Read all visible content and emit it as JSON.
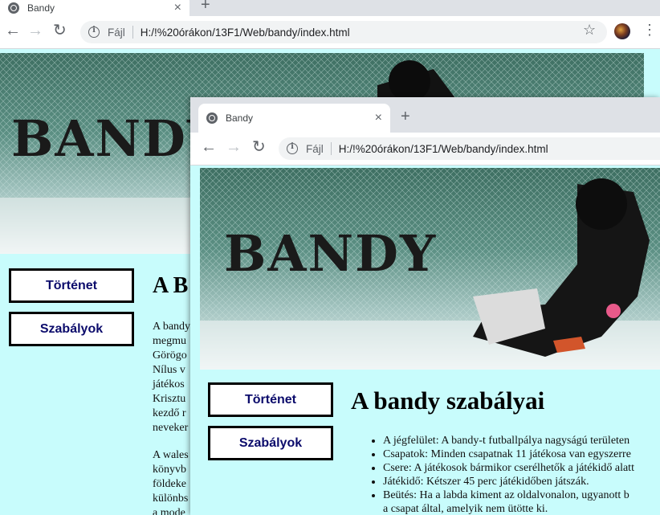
{
  "browser": {
    "tab_title": "Bandy",
    "close_glyph": "×",
    "new_tab_glyph": "+",
    "scheme_label": "Fájl",
    "url": "H:/!%20órákon/13F1/Web/bandy/index.html",
    "menu_glyph": "⋮",
    "star_glyph": "☆"
  },
  "page": {
    "banner_text": "BANDY",
    "nav": [
      "Történet",
      "Szabályok"
    ],
    "back_title_partial": "A B",
    "back_paragraph1": [
      "A bandy",
      "megmu",
      "Görögo",
      "Nílus v",
      "játékos",
      "Krisztu",
      "kezdő r",
      "neveker"
    ],
    "back_paragraph2": [
      "A wales",
      "könyvb",
      "földeke",
      "különbs",
      "a mode"
    ],
    "title": "A bandy szabályai",
    "rules": [
      "A jégfelület: A bandy-t futballpálya nagyságú területen",
      "Csapatok: Minden csapatnak 11 játékosa van egyszerre",
      "Csere: A játékosok bármikor cserélhetők a játékidő alatt",
      "Játékidő: Kétszer 45 perc játékidőben játszák.",
      "Beütés: Ha a labda kiment az oldalvonalon, ugyanott b",
      "a csapat által, amelyik nem ütötte ki."
    ]
  },
  "colors": {
    "page_bg": "#c8fcfc",
    "nav_text": "#0b0b6b"
  }
}
